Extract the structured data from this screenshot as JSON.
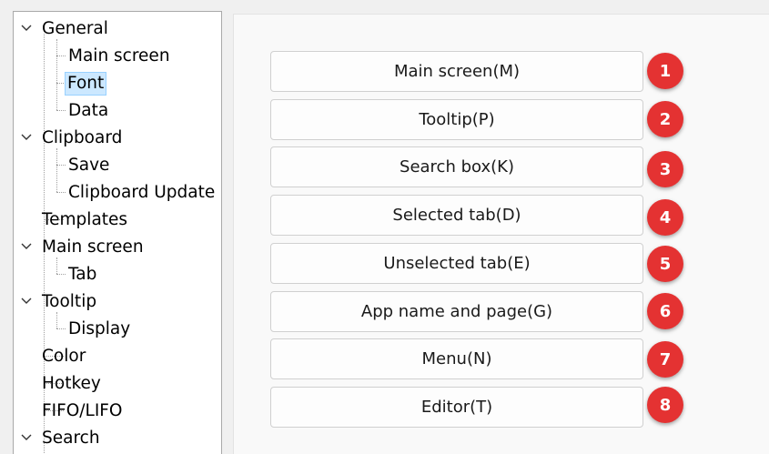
{
  "tree": {
    "items": [
      {
        "label": "General",
        "expanded": true
      },
      {
        "label": "Main screen"
      },
      {
        "label": "Font",
        "selected": true
      },
      {
        "label": "Data"
      },
      {
        "label": "Clipboard",
        "expanded": true
      },
      {
        "label": "Save"
      },
      {
        "label": "Clipboard Update"
      },
      {
        "label": "Templates"
      },
      {
        "label": "Main screen",
        "expanded": true
      },
      {
        "label": "Tab"
      },
      {
        "label": "Tooltip",
        "expanded": true
      },
      {
        "label": "Display"
      },
      {
        "label": "Color"
      },
      {
        "label": "Hotkey"
      },
      {
        "label": "FIFO/LIFO"
      },
      {
        "label": "Search",
        "expanded": true
      }
    ]
  },
  "font_buttons": [
    {
      "label": "Main screen(M)",
      "badge": "1"
    },
    {
      "label": "Tooltip(P)",
      "badge": "2"
    },
    {
      "label": "Search box(K)",
      "badge": "3"
    },
    {
      "label": "Selected tab(D)",
      "badge": "4"
    },
    {
      "label": "Unselected tab(E)",
      "badge": "5"
    },
    {
      "label": "App name and page(G)",
      "badge": "6"
    },
    {
      "label": "Menu(N)",
      "badge": "7"
    },
    {
      "label": "Editor(T)",
      "badge": "8"
    }
  ],
  "colors": {
    "badge": "#e43232",
    "selection_bg": "#cce8ff",
    "selection_border": "#99d1ff"
  }
}
